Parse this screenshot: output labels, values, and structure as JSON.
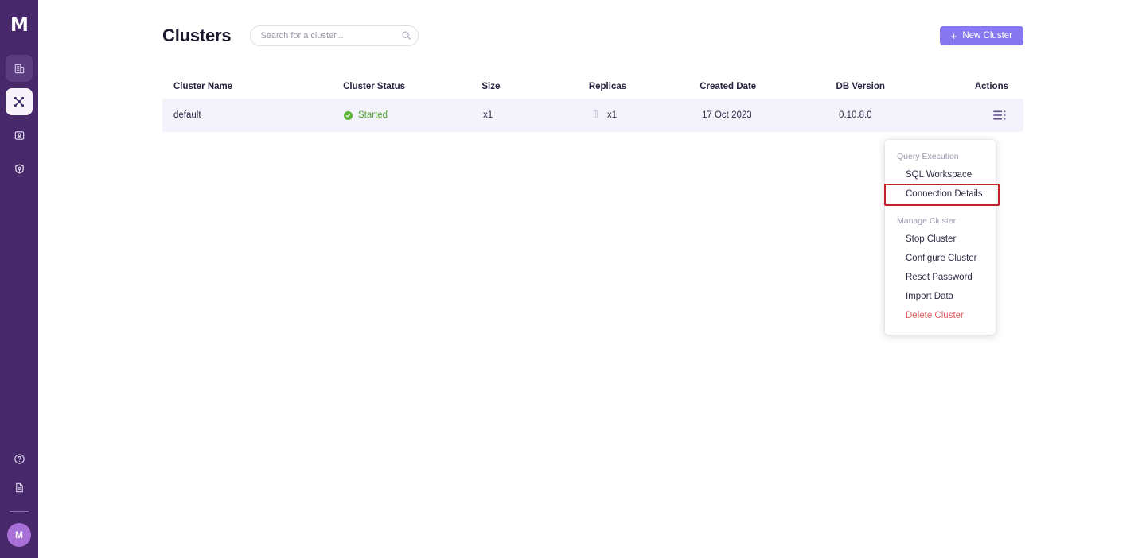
{
  "sidebar": {
    "logo_text": "M",
    "items": [
      {
        "name": "sidebar-item-workspaces",
        "icon": "building-icon",
        "state": "muted"
      },
      {
        "name": "sidebar-item-clusters",
        "icon": "cluster-nodes-icon",
        "state": "active"
      },
      {
        "name": "sidebar-item-users",
        "icon": "id-card-icon",
        "state": "default"
      },
      {
        "name": "sidebar-item-security",
        "icon": "shield-icon",
        "state": "default"
      }
    ],
    "bottom_items": [
      {
        "name": "help-icon",
        "icon": "question-circle-icon"
      },
      {
        "name": "docs-icon",
        "icon": "document-icon"
      }
    ],
    "avatar_text": "M"
  },
  "header": {
    "title": "Clusters",
    "search_placeholder": "Search for a cluster...",
    "search_value": "",
    "new_cluster_label": "New Cluster",
    "new_cluster_plus": "+",
    "accent_color": "#8878f0"
  },
  "table": {
    "columns": [
      "Cluster Name",
      "Cluster Status",
      "Size",
      "Replicas",
      "Created Date",
      "DB Version",
      "Actions"
    ],
    "rows": [
      {
        "cluster_name": "default",
        "cluster_status": "Started",
        "status_color": "#4ea72e",
        "size": "x1",
        "replicas": "x1",
        "created_date": "17 Oct 2023",
        "db_version": "0.10.8.0"
      }
    ]
  },
  "dropdown": {
    "group1_label": "Query Execution",
    "group1_items": [
      {
        "label": "SQL Workspace",
        "highlighted": false,
        "danger": false
      },
      {
        "label": "Connection Details",
        "highlighted": true,
        "danger": false
      }
    ],
    "group2_label": "Manage Cluster",
    "group2_items": [
      {
        "label": "Stop Cluster",
        "highlighted": false,
        "danger": false
      },
      {
        "label": "Configure Cluster",
        "highlighted": false,
        "danger": false
      },
      {
        "label": "Reset Password",
        "highlighted": false,
        "danger": false
      },
      {
        "label": "Import Data",
        "highlighted": false,
        "danger": false
      },
      {
        "label": "Delete Cluster",
        "highlighted": false,
        "danger": true
      }
    ],
    "highlight_color": "#c0202a",
    "danger_color": "#e35d5d"
  }
}
